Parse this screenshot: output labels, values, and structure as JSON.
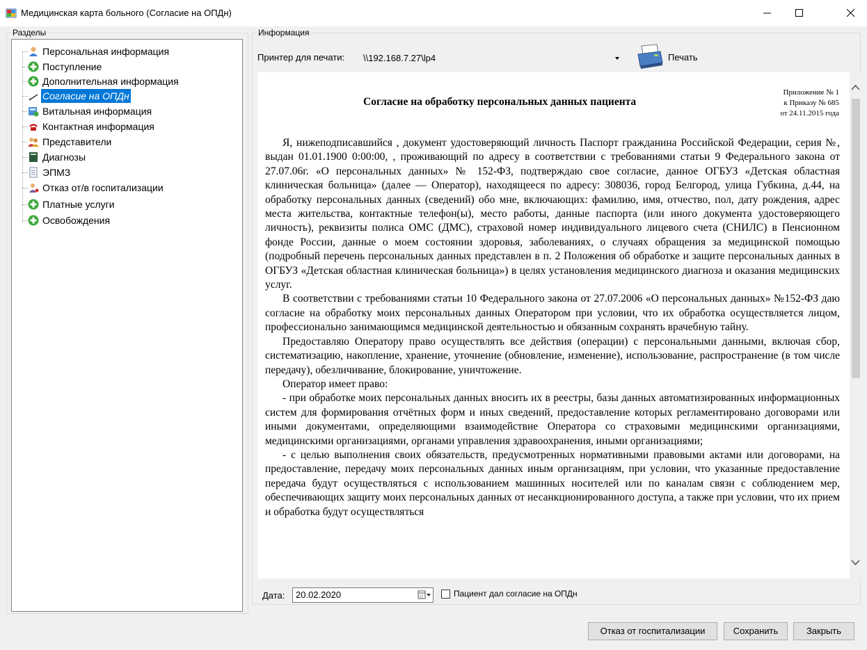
{
  "window": {
    "title": "Медицинская карта больного (Согласие на ОПДн)"
  },
  "sections": {
    "legend": "Разделы",
    "items": [
      {
        "label": "Персональная информация",
        "icon": "person-icon"
      },
      {
        "label": "Поступление",
        "icon": "green-plus-icon"
      },
      {
        "label": "Дополнительная информация",
        "icon": "green-plus-icon"
      },
      {
        "label": "Согласие на ОПДн",
        "icon": "pen-icon",
        "selected": true
      },
      {
        "label": "Витальная информация",
        "icon": "vitals-icon"
      },
      {
        "label": "Контактная информация",
        "icon": "phone-icon"
      },
      {
        "label": "Представители",
        "icon": "people-icon"
      },
      {
        "label": "Диагнозы",
        "icon": "book-icon"
      },
      {
        "label": "ЭПМЗ",
        "icon": "document-icon"
      },
      {
        "label": "Отказ от/в госпитализации",
        "icon": "refusal-icon"
      },
      {
        "label": "Платные услуги",
        "icon": "green-plus-icon"
      },
      {
        "label": "Освобождения",
        "icon": "green-plus-icon"
      }
    ]
  },
  "info": {
    "legend": "Информация",
    "printer_label": "Принтер для печати:",
    "printer_value": "\\\\192.168.7.27\\lp4",
    "print_button": "Печать"
  },
  "document": {
    "title": "Согласие на обработку персональных данных пациента",
    "appendix": [
      "Приложение № 1",
      "к Приказу № 685",
      "от 24.11.2015 года"
    ],
    "paragraphs": [
      "Я, нижеподписавшийся , документ удостоверяющий личность Паспорт гражданина Российской Федерации, серия №, выдан 01.01.1900 0:00:00, , проживающий по адресу в соответствии с требованиями статьи 9 Федерального закона от 27.07.06г. «О персональных данных» № 152-ФЗ, подтверждаю свое согласие, данное ОГБУЗ «Детская областная клиническая больница» (далее — Оператор), находящееся по адресу: 308036, город Белгород, улица Губкина, д.44, на обработку персональных данных (сведений) обо мне, включающих: фамилию, имя, отчество, пол, дату рождения, адрес места жительства, контактные телефон(ы), место работы, данные паспорта (или иного документа удостоверяющего личность), реквизиты полиса ОМС (ДМС), страховой номер индивидуального лицевого счета (СНИЛС) в Пенсионном фонде России, данные о моем состоянии здоровья, заболеваниях, о случаях обращения за медицинской помощью (подробный перечень персональных данных представлен в п. 2 Положения об обработке и защите персональных данных в ОГБУЗ «Детская областная клиническая больница») в целях установления медицинского диагноза и оказания медицинских услуг.",
      "В соответствии с требованиями статьи 10 Федерального закона от 27.07.2006 «О персональных данных» №152-ФЗ даю согласие на обработку моих персональных данных Оператором при условии, что их обработка осуществляется лицом, профессионально занимающимся медицинской деятельностью и обязанным сохранять врачебную тайну.",
      "Предоставляю Оператору право осуществлять все действия (операции) с персональными данными, включая сбор, систематизацию, накопление, хранение, уточнение (обновление, изменение), использование, распространение (в том числе передачу), обезличивание, блокирование, уничтожение.",
      "Оператор имеет право:",
      "- при обработке моих персональных данных вносить их в реестры, базы данных автоматизированных информационных систем для формирования отчётных форм и иных сведений, предоставление которых регламентировано договорами или иными документами, определяющими взаимодействие Оператора со страховыми медицинскими организациями, медицинскими организациями, органами управления здравоохранения, иными организациями;",
      "- с целью выполнения своих обязательств, предусмотренных нормативными правовыми актами или договорами, на предоставление, передачу моих персональных данных иным организациям, при условии, что указанные предоставление передача будут осуществляться с использованием машинных носителей или по каналам связи с соблюдением мер, обеспечивающих защиту моих персональных данных от несанкционированного доступа, а также при условии, что их прием и обработка будут осуществляться"
    ]
  },
  "footer": {
    "date_label": "Дата:",
    "date_value": "20.02.2020",
    "consent_label": "Пациент дал согласие на ОПДн",
    "consent_checked": false,
    "refuse_button": "Отказ от госпитализации",
    "save_button": "Сохранить",
    "close_button": "Закрыть"
  }
}
